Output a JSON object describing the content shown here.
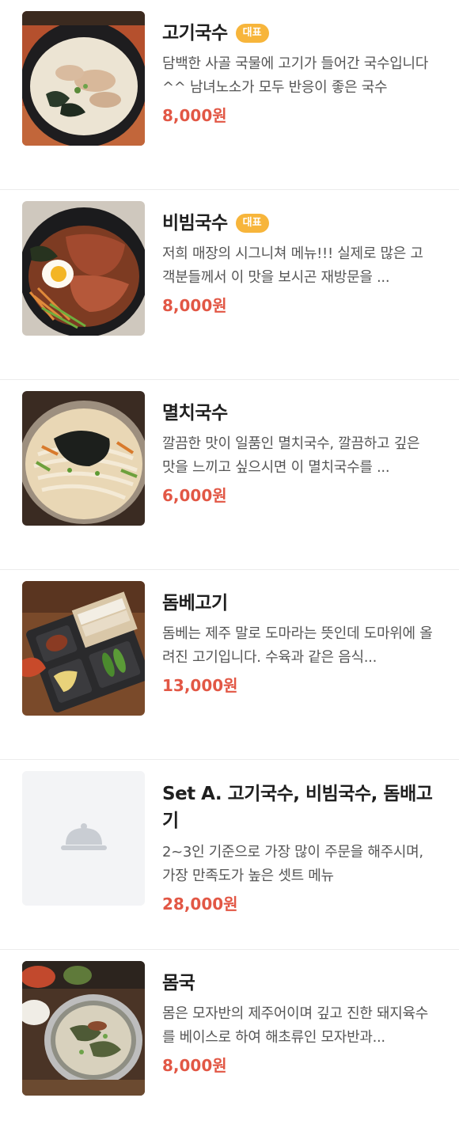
{
  "menu": {
    "items": [
      {
        "name": "고기국수",
        "badge": "대표",
        "desc": "담백한 사골 국물에 고기가 들어간 국수입니다^^ 남녀노소가 모두 반응이 좋은 국수",
        "price": "8,000원",
        "image": "pork-noodle-photo"
      },
      {
        "name": "비빔국수",
        "badge": "대표",
        "desc": "저희 매장의 시그니쳐 메뉴!!! 실제로 많은 고객분들께서 이 맛을 보시곤 재방문을 ...",
        "price": "8,000원",
        "image": "spicy-noodle-photo"
      },
      {
        "name": "멸치국수",
        "desc": "깔끔한 맛이 일품인 멸치국수, 깔끔하고 깊은 맛을 느끼고 싶으시면 이 멸치국수를 ...",
        "price": "6,000원",
        "image": "anchovy-noodle-photo"
      },
      {
        "name": "돔베고기",
        "desc": "돔베는 제주 말로 도마라는 뜻인데 도마위에 올려진 고기입니다. 수육과 같은 음식...",
        "price": "13,000원",
        "image": "dombe-pork-photo"
      },
      {
        "name": "Set A. 고기국수, 비빔국수, 돔배고기",
        "desc": "2~3인 기준으로 가장 많이 주문을 해주시며, 가장 만족도가 높은 셋트 메뉴",
        "price": "28,000원",
        "image": "cloche-icon"
      },
      {
        "name": "몸국",
        "desc": "몸은 모자반의 제주어이며 깊고 진한 돼지육수를 베이스로 하여 해초류인 모자반과...",
        "price": "8,000원",
        "image": "momguk-soup-photo"
      }
    ]
  },
  "colors": {
    "price": "#e25745",
    "badge": "#f7b53b",
    "divider": "#ececec",
    "placeholder_bg": "#f3f4f6"
  }
}
